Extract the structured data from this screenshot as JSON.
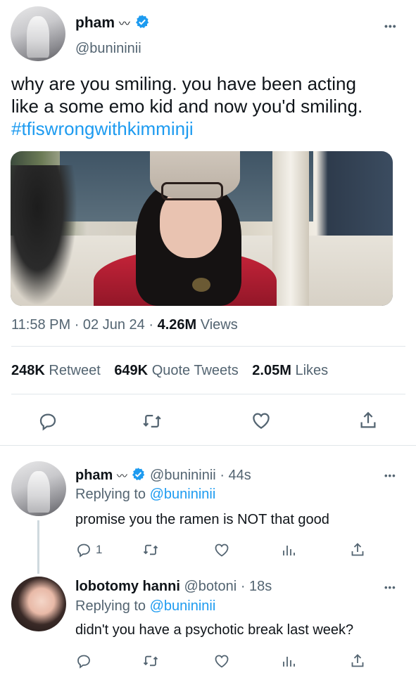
{
  "tweet": {
    "author": {
      "name": "pham",
      "name_suffix": "〰",
      "handle": "@bunininii"
    },
    "text_lines": [
      "why are you smiling. you have been acting",
      "like a some emo kid and now you'd smiling."
    ],
    "hashtag": "#tfiswrongwithkimminji",
    "meta": {
      "time": "11:58 PM",
      "date": "02 Jun 24",
      "views_count": "4.26M",
      "views_label": "Views",
      "sep": "·"
    },
    "stats": {
      "retweets_count": "248K",
      "retweets_label": "Retweet",
      "quotes_count": "649K",
      "quotes_label": "Quote Tweets",
      "likes_count": "2.05M",
      "likes_label": "Likes"
    },
    "more": "•••"
  },
  "replies": [
    {
      "name": "pham",
      "name_suffix": "〰",
      "handle": "@bunininii",
      "sep": "·",
      "time": "44s",
      "replying_prefix": "Replying to",
      "replying_to": "@bunininii",
      "text": "promise you the ramen is NOT that good",
      "reply_count": "1",
      "more": "•••"
    },
    {
      "name": "lobotomy hanni",
      "handle": "@botoni",
      "sep": "·",
      "time": "18s",
      "replying_prefix": "Replying to",
      "replying_to": "@bunininii",
      "text": "didn't you have a psychotic break last week?",
      "reply_count": "",
      "more": "•••"
    }
  ],
  "colors": {
    "link": "#1d9bf0",
    "secondary_text": "#536471",
    "verified": "#1d9bf0",
    "divider": "#e1e6ea"
  },
  "icons": [
    "verified-badge-icon",
    "reply-icon",
    "retweet-icon",
    "like-icon",
    "share-icon",
    "analytics-icon",
    "more-icon"
  ]
}
